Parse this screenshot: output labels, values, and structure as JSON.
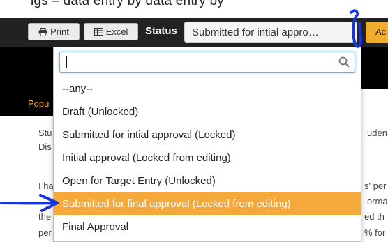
{
  "page": {
    "top_caption": "igs – data entry by data entry by"
  },
  "toolbar": {
    "print_label": "Print",
    "excel_label": "Excel",
    "status_label": "Status",
    "status_value": "Submitted for intial appro…",
    "actions_label": "Ac"
  },
  "background": {
    "popup_label": "Popu",
    "line1_left": "Stu",
    "line1_right": "uden",
    "line2_left": "Dis",
    "line3_left": "I ha",
    "line3_right": "s' per",
    "line4_right": "orma",
    "line5_left": "the",
    "line5_right": "ed th",
    "line6_left": "per",
    "line6_right": "% for"
  },
  "dropdown": {
    "search_value": "",
    "search_placeholder": "",
    "options": [
      {
        "label": "--any--",
        "selected": false
      },
      {
        "label": "Draft (Unlocked)",
        "selected": false
      },
      {
        "label": "Submitted for intial approval (Locked)",
        "selected": false
      },
      {
        "label": "Initial approval (Locked from editing)",
        "selected": false
      },
      {
        "label": "Open for Target Entry (Unlocked)",
        "selected": false
      },
      {
        "label": "Submitted for final approval (Locked from editing)",
        "selected": true
      },
      {
        "label": "Final Approval",
        "selected": false
      }
    ],
    "highlight_color": "#f5a93a"
  },
  "annotations": {
    "pen_color": "#1733e0",
    "arrow_icon": "hand-drawn-arrow-icon",
    "marker_icon": "hand-drawn-marker-icon"
  }
}
